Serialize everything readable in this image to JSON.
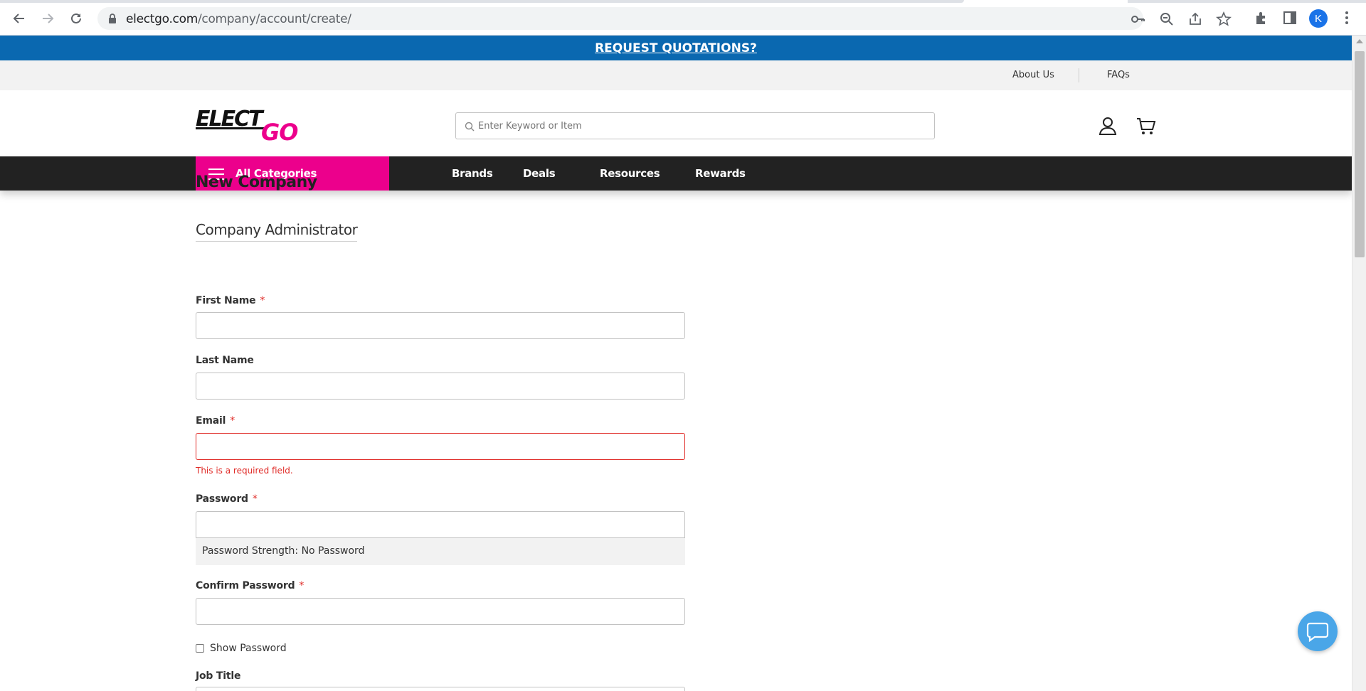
{
  "browser": {
    "url_host": "electgo.com",
    "url_path": "/company/account/create/",
    "profile_initial": "K"
  },
  "promo": {
    "text": "REQUEST QUOTATIONS?"
  },
  "topbar": {
    "about": "About Us",
    "faqs": "FAQs"
  },
  "header": {
    "logo_top": "ELECT",
    "logo_bottom": "GO",
    "search_placeholder": "Enter Keyword or Item"
  },
  "nav": {
    "all_categories": "All Categories",
    "links": [
      "Brands",
      "Deals",
      "Resources",
      "Rewards"
    ]
  },
  "form": {
    "title": "New Company",
    "section": "Company Administrator",
    "first_name_label": "First Name",
    "last_name_label": "Last Name",
    "email_label": "Email",
    "email_error": "This is a required field.",
    "password_label": "Password",
    "password_strength": "Password Strength: No Password",
    "confirm_label": "Confirm Password",
    "show_password": "Show Password",
    "job_title_label": "Job Title",
    "required_mark": "*"
  },
  "colors": {
    "promo_bg": "#0a68b0",
    "brand_pink": "#ec008c",
    "nav_bg": "#222222",
    "error": "#e02b27"
  }
}
